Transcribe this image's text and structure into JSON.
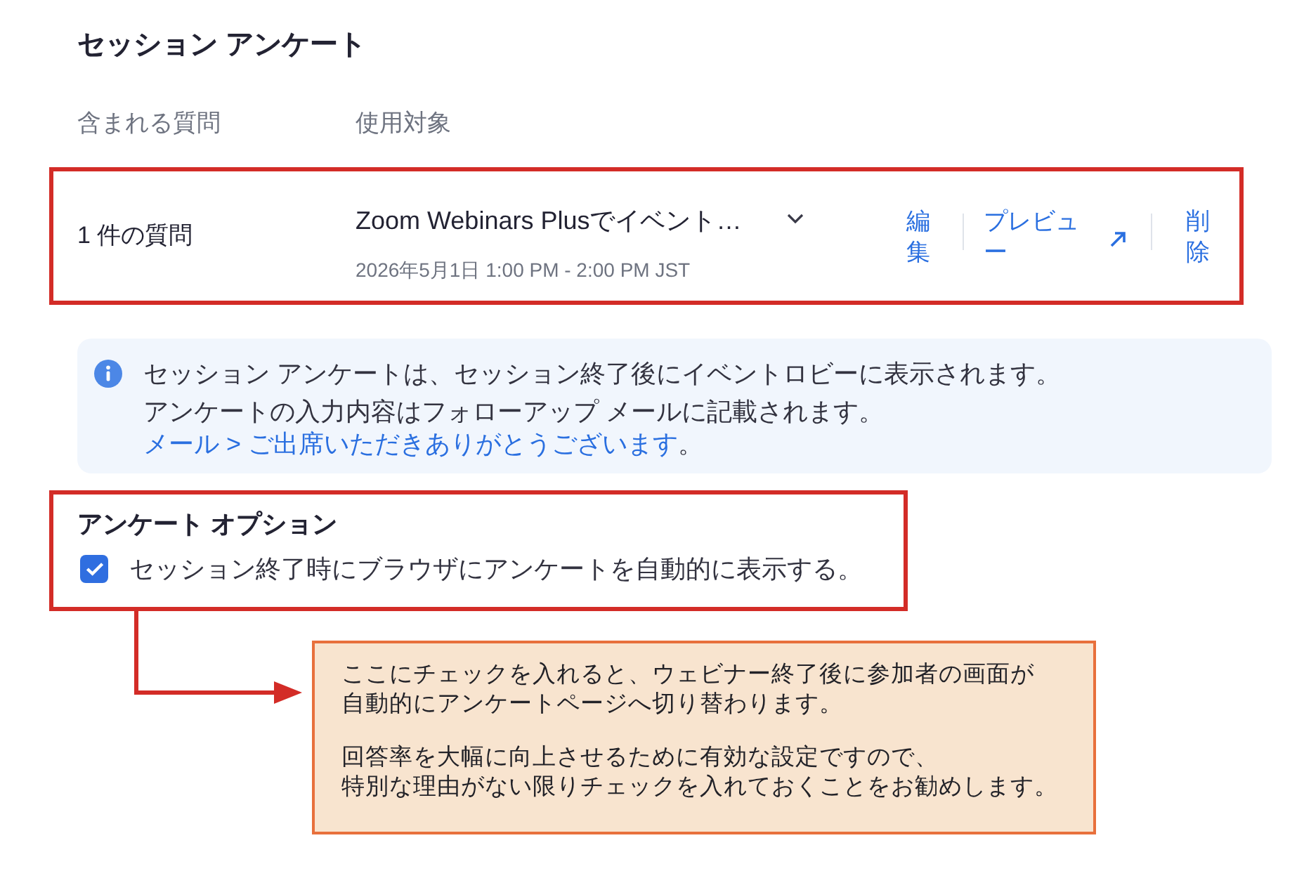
{
  "title": "セッション アンケート",
  "table": {
    "columns": [
      "含まれる質問",
      "使用対象"
    ],
    "rows": [
      {
        "highlighted": true,
        "question_count": "1 件の質問",
        "survey": {
          "name": "Zoom Webinars Plusでイベント…",
          "date": "2026年5月1日 1:00 PM - 2:00 PM JST"
        },
        "actions": [
          {
            "label": "編集",
            "kind": "link"
          },
          {
            "label": "プレビュー",
            "kind": "external"
          },
          {
            "label": "削除",
            "kind": "link"
          }
        ]
      }
    ]
  },
  "info": {
    "text": "セッション アンケートは、セッション終了後にイベントロビーに表示されます。",
    "note": "アンケートの入力内容はフォローアップ メールに記載されます。",
    "link": "メール > ご出席いただきありがとうございます",
    "link_suffix": "。"
  },
  "options": {
    "highlighted": true,
    "title": "アンケート オプション",
    "items": [
      {
        "label": "セッション終了時にブラウザにアンケートを自動的に表示する。",
        "checked": true
      }
    ]
  },
  "callout": {
    "paragraphs": [
      [
        "ここにチェックを入れると、ウェビナー終了後に参加者の画面が",
        "自動的にアンケートページへ切り替わります。"
      ],
      [
        "回答率を大幅に向上させるために有効な設定ですので、",
        "特別な理由がない限りチェックを入れておくことをお勧めします。"
      ]
    ]
  }
}
